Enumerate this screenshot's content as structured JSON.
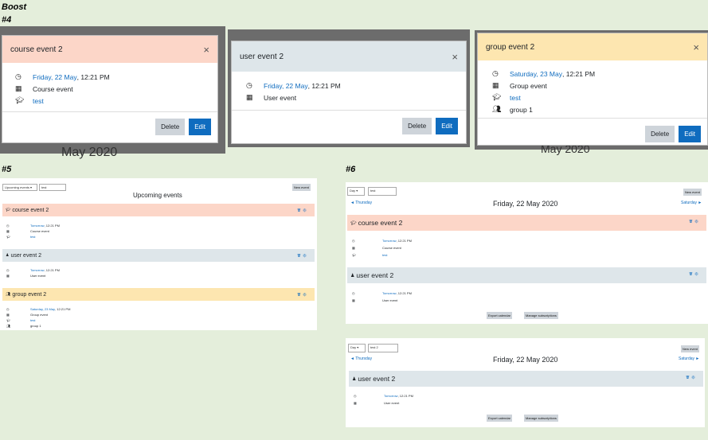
{
  "labels": {
    "boost": "Boost",
    "n4": "#4",
    "n5": "#5",
    "n6": "#6"
  },
  "modals": [
    {
      "title": "course event 2",
      "close": "×",
      "date_link": "Friday, 22 May",
      "time": ", 12:21 PM",
      "type": "Course event",
      "course_link": "test",
      "delete": "Delete",
      "edit": "Edit"
    },
    {
      "title": "user event 2",
      "close": "×",
      "date_link": "Friday, 22 May",
      "time": ", 12:21 PM",
      "type": "User event",
      "delete": "Delete",
      "edit": "Edit"
    },
    {
      "title": "group event 2",
      "close": "×",
      "date_link": "Saturday, 23 May",
      "time": ", 12:21 PM",
      "type": "Group event",
      "course_link": "test",
      "group": "group 1",
      "delete": "Delete",
      "edit": "Edit"
    }
  ],
  "background_text": {
    "month1": "May 2020",
    "month2": "May 2020"
  },
  "upcoming": {
    "select1": "Upcoming events ▾",
    "select2": "test",
    "new_event": "New event",
    "title": "Upcoming events",
    "events": [
      {
        "title": "course event 2",
        "when": "Tomorrow",
        "time": ", 12:21 PM",
        "type": "Course event",
        "course": "test"
      },
      {
        "title": "user event 2",
        "when": "Tomorrow",
        "time": ", 12:21 PM",
        "type": "User event"
      },
      {
        "title": "group event 2",
        "when": "Saturday, 23 May",
        "time": ", 12:21 PM",
        "type": "Group event",
        "course": "test",
        "group": "group 1"
      }
    ]
  },
  "day1": {
    "select1": "Day ▾",
    "select2": "test",
    "new_event": "New event",
    "prev": "◄ Thursday",
    "title": "Friday, 22 May 2020",
    "next": "Saturday ►",
    "events": [
      {
        "title": "course event 2",
        "when": "Tomorrow",
        "time": ", 12:21 PM",
        "type": "Course event",
        "course": "test"
      },
      {
        "title": "user event 2",
        "when": "Tomorrow",
        "time": ", 12:21 PM",
        "type": "User event"
      }
    ],
    "export": "Export calendar",
    "manage": "Manage subscriptions"
  },
  "day2": {
    "select1": "Day ▾",
    "select2": "test 2",
    "new_event": "New event",
    "prev": "◄ Thursday",
    "title": "Friday, 22 May 2020",
    "next": "Saturday ►",
    "events": [
      {
        "title": "user event 2",
        "when": "Tomorrow",
        "time": ", 12:21 PM",
        "type": "User event"
      }
    ],
    "export": "Export calendar",
    "manage": "Manage subscriptions"
  },
  "icons": {
    "clock": "clock-icon",
    "calendar": "calendar-icon",
    "course": "graduation-cap-icon",
    "group": "users-icon",
    "user": "user-icon"
  },
  "colors": {
    "course": "#fcd6c8",
    "user": "#dee6ea",
    "group": "#fde6b0",
    "link": "#0f6cbf"
  }
}
